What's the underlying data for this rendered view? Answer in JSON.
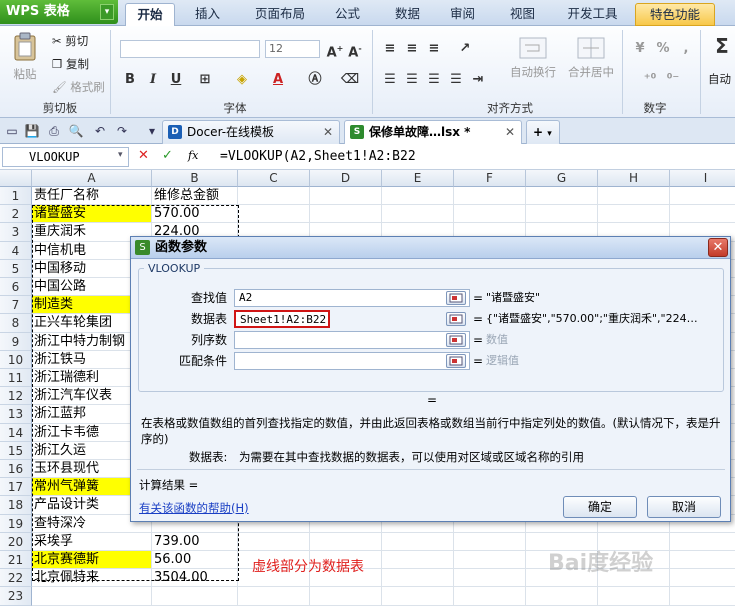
{
  "app": {
    "name": "WPS 表格"
  },
  "ribbon_tabs": [
    "开始",
    "插入",
    "页面布局",
    "公式",
    "数据",
    "审阅",
    "视图",
    "开发工具",
    "特色功能"
  ],
  "ribbon": {
    "clipboard": {
      "paste": "粘贴",
      "cut": "剪切",
      "copy": "复制",
      "format_painter": "格式刷",
      "label": "剪切板"
    },
    "font": {
      "size": "12",
      "bold": "B",
      "italic": "I",
      "underline": "U",
      "label": "字体"
    },
    "alignment": {
      "wrap": "自动换行",
      "merge": "合并居中",
      "label": "对齐方式"
    },
    "number": {
      "label": "数字",
      "percent": "%",
      "sum": "自动"
    }
  },
  "doc_tabs": [
    {
      "label": "Docer-在线模板",
      "active": false
    },
    {
      "label": "保修单故障…lsx *",
      "active": true
    }
  ],
  "formula_bar": {
    "name_box": "VLOOKUP",
    "formula": "=VLOOKUP(A2,Sheet1!A2:B22",
    "fx": "fx",
    "cancel": "✕",
    "confirm": "✓"
  },
  "columns": [
    "A",
    "B",
    "C",
    "D",
    "E",
    "F",
    "G",
    "H",
    "I"
  ],
  "rows": [
    {
      "n": "1",
      "a": "责任厂名称",
      "b": "维修总金额",
      "hl": false
    },
    {
      "n": "2",
      "a": "诸暨盛安",
      "b": "570.00",
      "hl": true
    },
    {
      "n": "3",
      "a": "重庆润禾",
      "b": "224.00",
      "hl": false
    },
    {
      "n": "4",
      "a": "中信机电",
      "b": "",
      "hl": false
    },
    {
      "n": "5",
      "a": "中国移动",
      "b": "",
      "hl": false
    },
    {
      "n": "6",
      "a": "中国公路",
      "b": "",
      "hl": false
    },
    {
      "n": "7",
      "a": "制造类",
      "b": "",
      "hl": true
    },
    {
      "n": "8",
      "a": "正兴车轮集团",
      "b": "",
      "hl": false
    },
    {
      "n": "9",
      "a": "浙江中特力制钢",
      "b": "",
      "hl": false
    },
    {
      "n": "10",
      "a": "浙江铁马",
      "b": "",
      "hl": false
    },
    {
      "n": "11",
      "a": "浙江瑞德利",
      "b": "",
      "hl": false
    },
    {
      "n": "12",
      "a": "浙江汽车仪表",
      "b": "",
      "hl": false
    },
    {
      "n": "13",
      "a": "浙江蓝邦",
      "b": "",
      "hl": false
    },
    {
      "n": "14",
      "a": "浙江卡韦德",
      "b": "",
      "hl": false
    },
    {
      "n": "15",
      "a": "浙江久运",
      "b": "",
      "hl": false
    },
    {
      "n": "16",
      "a": "玉环县现代",
      "b": "",
      "hl": false
    },
    {
      "n": "17",
      "a": "常州气弹簧",
      "b": "",
      "hl": true
    },
    {
      "n": "18",
      "a": "产品设计类",
      "b": "",
      "hl": false
    },
    {
      "n": "19",
      "a": "查特深冷",
      "b": "",
      "hl": false
    },
    {
      "n": "20",
      "a": "采埃孚",
      "b": "739.00",
      "hl": false
    },
    {
      "n": "21",
      "a": "北京赛德斯",
      "b": "56.00",
      "hl": true
    },
    {
      "n": "22",
      "a": "北京佩特来",
      "b": "3504.00",
      "hl": false
    },
    {
      "n": "23",
      "a": "",
      "b": "",
      "hl": false
    }
  ],
  "annotation": "虚线部分为数据表",
  "dialog": {
    "title": "函数参数",
    "close": "✕",
    "group": "VLOOKUP",
    "fields": [
      {
        "label": "查找值",
        "value": "A2",
        "result": "\"诸暨盛安\"",
        "grey": false
      },
      {
        "label": "数据表",
        "value": "Sheet1!A2:B22",
        "result": "{\"诸暨盛安\",\"570.00\";\"重庆润禾\",\"224…",
        "grey": false
      },
      {
        "label": "列序数",
        "value": "",
        "result": "数值",
        "grey": true
      },
      {
        "label": "匹配条件",
        "value": "",
        "result": "逻辑值",
        "grey": true
      }
    ],
    "equals": "=",
    "desc": "在表格或数值数组的首列查找指定的数值，并由此返回表格或数组当前行中指定列处的数值。(默认情况下，表是升序的)",
    "param_name": "数据表:",
    "param_desc": "为需要在其中查找数据的数据表，可以使用对区域或区域名称的引用",
    "calc_result": "计算结果 =",
    "help_link": "有关该函数的帮助(H)",
    "ok": "确定",
    "cancel": "取消"
  },
  "colors": {
    "highlight": "#ffff00",
    "annotation_red": "#e0201e",
    "link_blue": "#1a3fc4"
  },
  "watermark": "Bai度经验"
}
